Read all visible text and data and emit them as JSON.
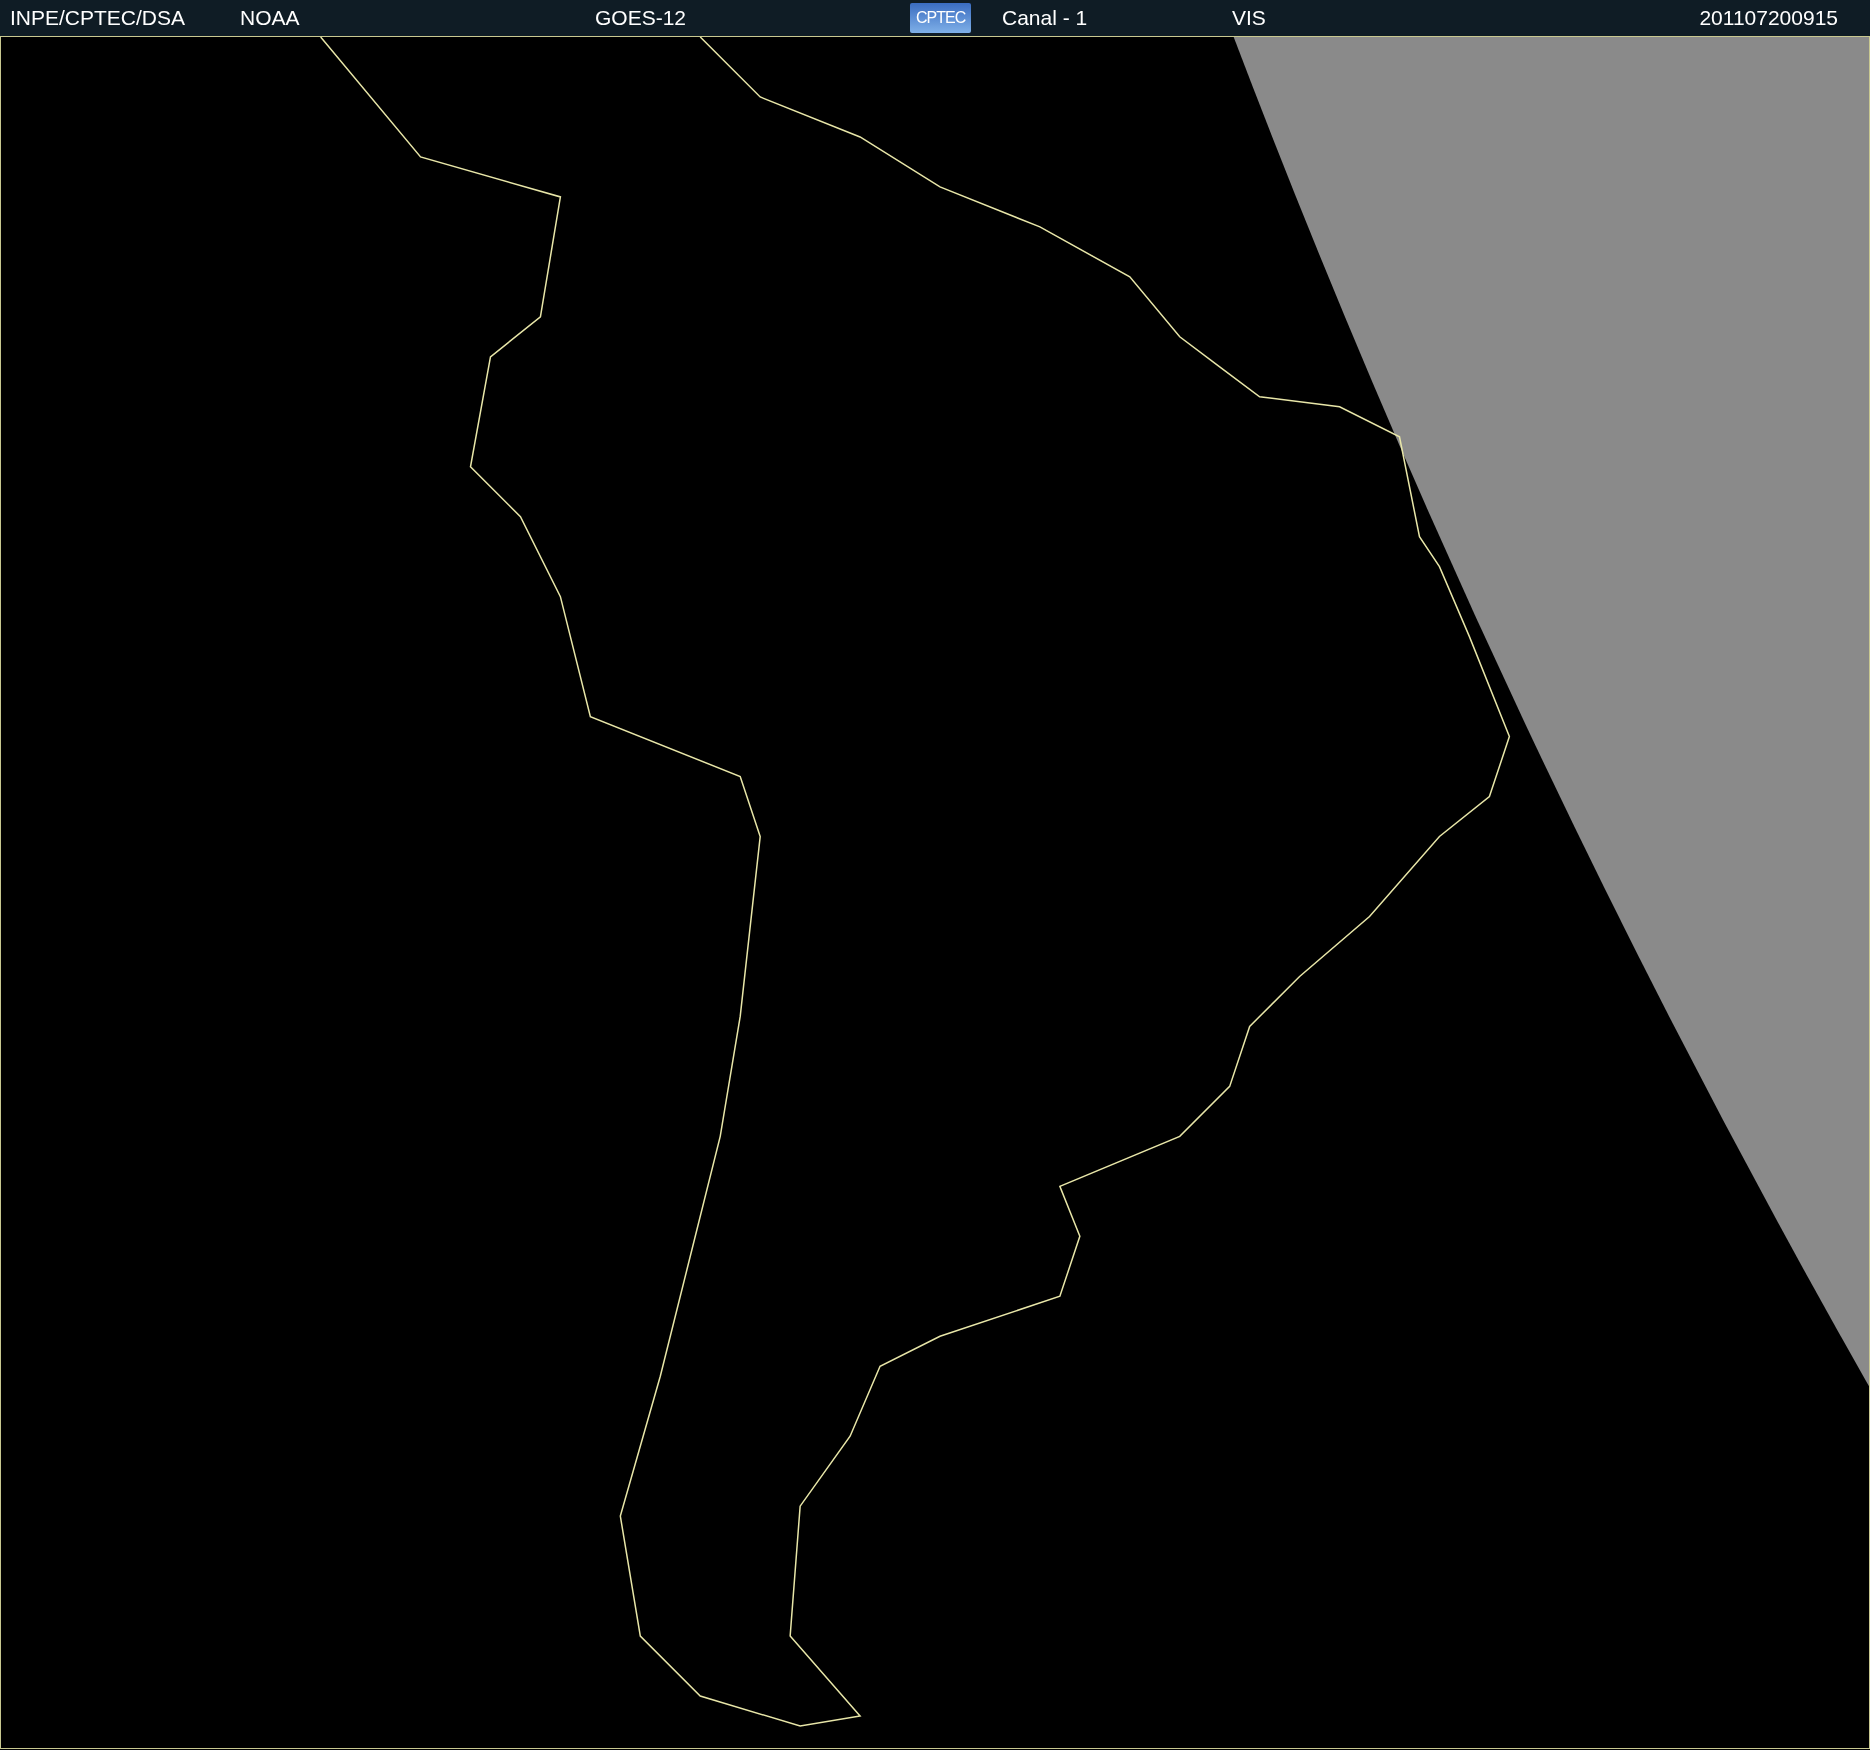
{
  "header": {
    "items": [
      {
        "kind": "text",
        "text": "INPE/CPTEC/DSA"
      },
      {
        "kind": "text",
        "text": "NOAA"
      },
      {
        "kind": "text",
        "text": "GOES-12"
      },
      {
        "kind": "logo",
        "text": "CPTEC"
      },
      {
        "kind": "text",
        "text": "Canal - 1"
      },
      {
        "kind": "text",
        "text": "VIS"
      },
      {
        "kind": "text",
        "text": "201107200915"
      }
    ]
  }
}
